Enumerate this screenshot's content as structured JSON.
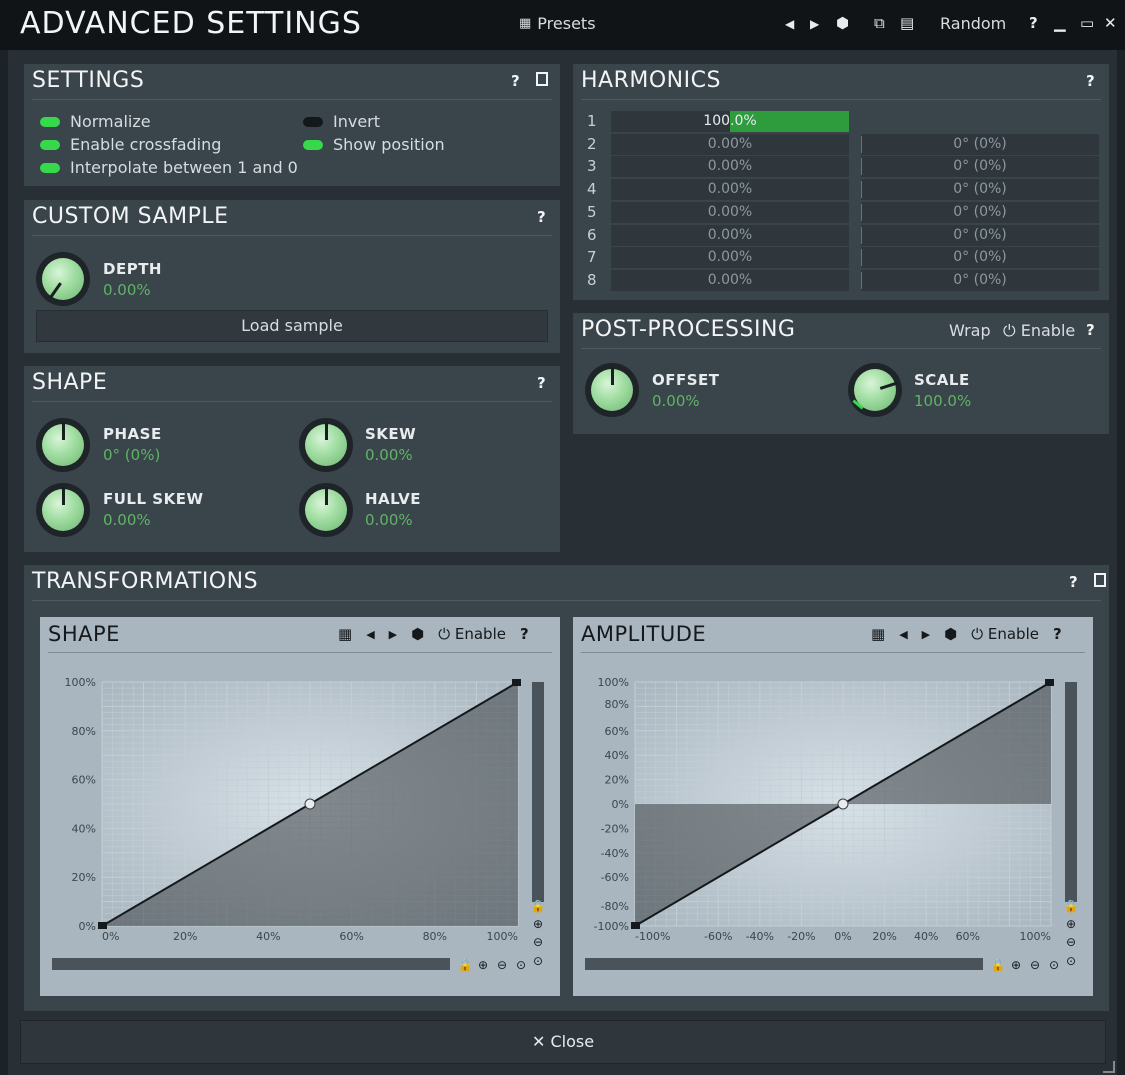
{
  "window": {
    "title": "ADVANCED SETTINGS",
    "presets_label": "Presets",
    "random_label": "Random",
    "help": "?",
    "prev": "◀",
    "next": "▶"
  },
  "settings": {
    "title": "SETTINGS",
    "help": "?",
    "toggles": [
      {
        "label": "Normalize",
        "on": true
      },
      {
        "label": "Enable crossfading",
        "on": true
      },
      {
        "label": "Interpolate between 1 and 0",
        "on": true
      },
      {
        "label": "Invert",
        "on": false
      },
      {
        "label": "Show position",
        "on": true
      }
    ]
  },
  "custom_sample": {
    "title": "CUSTOM SAMPLE",
    "help": "?",
    "depth_label": "DEPTH",
    "depth_value": "0.00%",
    "depth_level": 0.0,
    "load_label": "Load sample"
  },
  "shape": {
    "title": "SHAPE",
    "help": "?",
    "knobs": [
      {
        "label": "PHASE",
        "value": "0° (0%)"
      },
      {
        "label": "SKEW",
        "value": "0.00%"
      },
      {
        "label": "FULL SKEW",
        "value": "0.00%"
      },
      {
        "label": "HALVE",
        "value": "0.00%"
      }
    ]
  },
  "harmonics": {
    "title": "HARMONICS",
    "help": "?",
    "rows": [
      {
        "n": "1",
        "amp": "100.0%",
        "amp_level": 1.0,
        "phase": ""
      },
      {
        "n": "2",
        "amp": "0.00%",
        "amp_level": 0.0,
        "phase": "0° (0%)"
      },
      {
        "n": "3",
        "amp": "0.00%",
        "amp_level": 0.0,
        "phase": "0° (0%)"
      },
      {
        "n": "4",
        "amp": "0.00%",
        "amp_level": 0.0,
        "phase": "0° (0%)"
      },
      {
        "n": "5",
        "amp": "0.00%",
        "amp_level": 0.0,
        "phase": "0° (0%)"
      },
      {
        "n": "6",
        "amp": "0.00%",
        "amp_level": 0.0,
        "phase": "0° (0%)"
      },
      {
        "n": "7",
        "amp": "0.00%",
        "amp_level": 0.0,
        "phase": "0° (0%)"
      },
      {
        "n": "8",
        "amp": "0.00%",
        "amp_level": 0.0,
        "phase": "0° (0%)"
      }
    ]
  },
  "post_processing": {
    "title": "POST-PROCESSING",
    "wrap_label": "Wrap",
    "enable_label": "Enable",
    "help": "?",
    "knobs": [
      {
        "label": "OFFSET",
        "value": "0.00%"
      },
      {
        "label": "SCALE",
        "value": "100.0%"
      }
    ]
  },
  "transformations": {
    "title": "TRANSFORMATIONS",
    "help": "?",
    "shape_graph": {
      "title": "SHAPE",
      "enable_label": "Enable",
      "help": "?",
      "y_ticks": [
        "100%",
        "80%",
        "60%",
        "40%",
        "20%",
        "0%"
      ],
      "x_ticks": [
        "0%",
        "20%",
        "40%",
        "60%",
        "80%",
        "100%"
      ]
    },
    "amplitude_graph": {
      "title": "AMPLITUDE",
      "enable_label": "Enable",
      "help": "?",
      "y_ticks": [
        "100%",
        "80%",
        "60%",
        "40%",
        "20%",
        "0%",
        "-20%",
        "-40%",
        "-60%",
        "-80%",
        "-100%"
      ],
      "x_ticks": [
        "-100%",
        "-60%",
        "-40%",
        "-20%",
        "0%",
        "20%",
        "40%",
        "60%",
        "100%"
      ]
    }
  },
  "close_label": "✕ Close"
}
